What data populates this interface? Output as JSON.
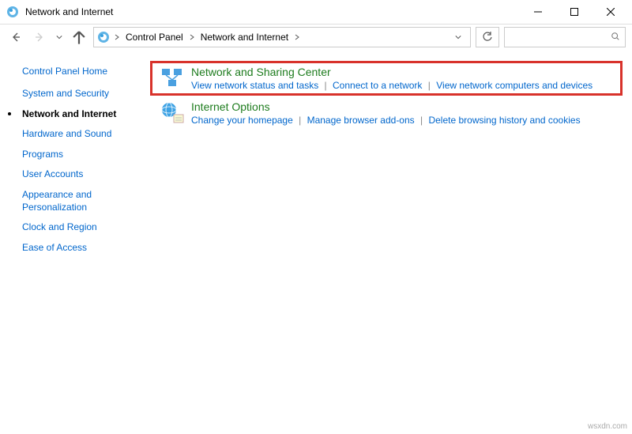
{
  "window": {
    "title": "Network and Internet"
  },
  "breadcrumb": {
    "item1": "Control Panel",
    "item2": "Network and Internet"
  },
  "search": {
    "placeholder": ""
  },
  "sidebar": {
    "home": "Control Panel Home",
    "items": [
      "System and Security",
      "Network and Internet",
      "Hardware and Sound",
      "Programs",
      "User Accounts",
      "Appearance and Personalization",
      "Clock and Region",
      "Ease of Access"
    ],
    "active_index": 1
  },
  "sections": [
    {
      "title": "Network and Sharing Center",
      "links": [
        "View network status and tasks",
        "Connect to a network",
        "View network computers and devices"
      ]
    },
    {
      "title": "Internet Options",
      "links": [
        "Change your homepage",
        "Manage browser add-ons",
        "Delete browsing history and cookies"
      ]
    }
  ],
  "watermark": "wsxdn.com"
}
